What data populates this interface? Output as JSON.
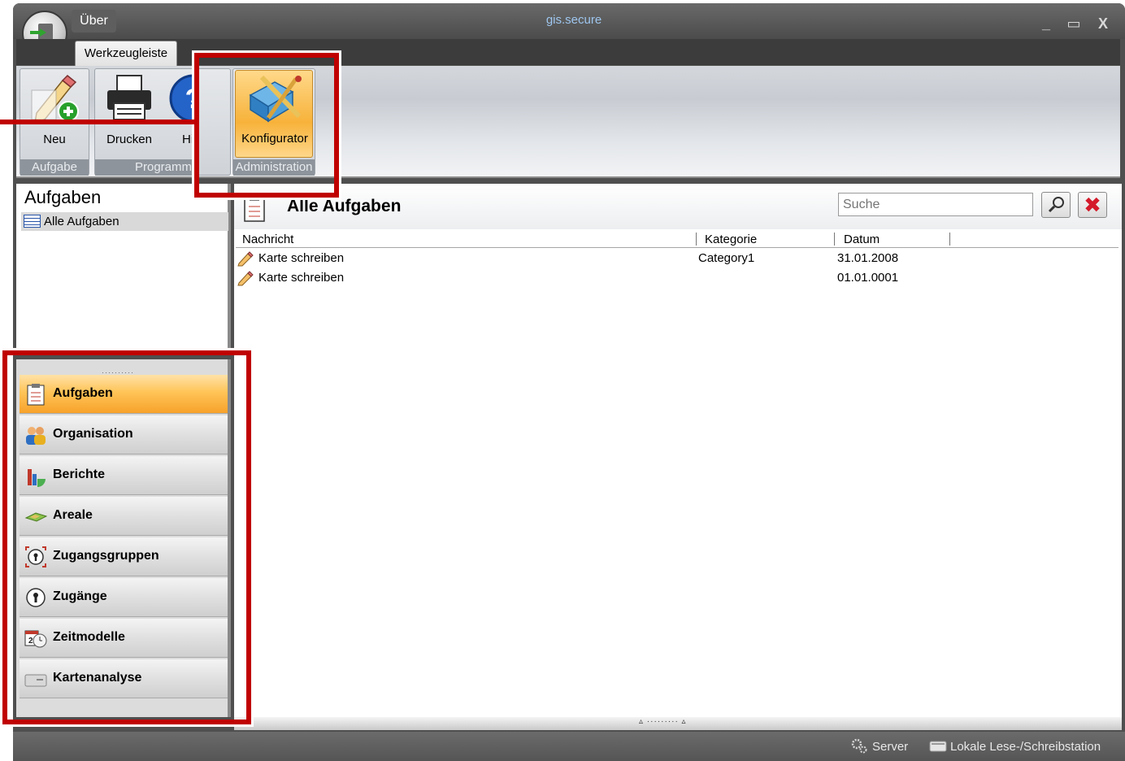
{
  "app": {
    "title": "gis.secure",
    "menu_label": "Über"
  },
  "ribbon": {
    "tab_label": "Werkzeugleiste",
    "groups": [
      {
        "label": "Aufgabe",
        "buttons": [
          {
            "label": "Neu",
            "icon": "new-pencil-icon"
          }
        ]
      },
      {
        "label": "Programm",
        "buttons": [
          {
            "label": "Drucken",
            "icon": "printer-icon"
          },
          {
            "label": "Hilfe",
            "icon": "help-icon"
          }
        ]
      },
      {
        "label": "Administration",
        "buttons": [
          {
            "label": "Konfigurator",
            "icon": "configurator-icon"
          }
        ]
      }
    ]
  },
  "left_panel": {
    "title": "Aufgaben",
    "selected_item": "Alle Aufgaben"
  },
  "nav": {
    "items": [
      {
        "label": "Aufgaben",
        "icon": "clipboard-icon",
        "active": true
      },
      {
        "label": "Organisation",
        "icon": "people-icon",
        "active": false
      },
      {
        "label": "Berichte",
        "icon": "chart-icon",
        "active": false
      },
      {
        "label": "Areale",
        "icon": "map-icon",
        "active": false
      },
      {
        "label": "Zugangsgruppen",
        "icon": "keyhole-group-icon",
        "active": false
      },
      {
        "label": "Zugänge",
        "icon": "keyhole-icon",
        "active": false
      },
      {
        "label": "Zeitmodelle",
        "icon": "calendar-clock-icon",
        "active": false
      },
      {
        "label": "Kartenanalyse",
        "icon": "card-icon",
        "active": false
      }
    ]
  },
  "content": {
    "title": "Alle Aufgaben",
    "search_placeholder": "Suche",
    "columns": [
      "Nachricht",
      "Kategorie",
      "Datum"
    ],
    "rows": [
      {
        "nachricht": "Karte schreiben",
        "kategorie": "Category1",
        "datum": "31.01.2008"
      },
      {
        "nachricht": "Karte schreiben",
        "kategorie": "",
        "datum": "01.01.0001"
      }
    ]
  },
  "statusbar": {
    "server": "Server",
    "station": "Lokale Lese-/Schreibstation"
  },
  "colors": {
    "highlight_red": "#c00000",
    "active_orange": "#f7a22b",
    "title_blue": "#9ec6ef"
  }
}
